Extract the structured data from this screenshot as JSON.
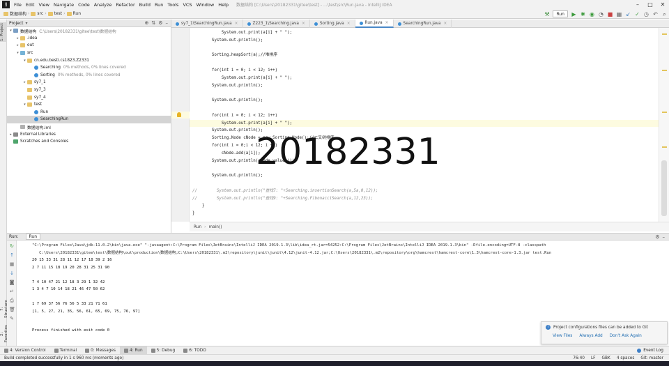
{
  "titlebar": {
    "logo": "IJ",
    "menus": [
      "File",
      "Edit",
      "View",
      "Navigate",
      "Code",
      "Analyze",
      "Refactor",
      "Build",
      "Run",
      "Tools",
      "VCS",
      "Window",
      "Help"
    ],
    "window_title": "数据结构 [C:\\Users\\20182331\\gitee\\test] - ...\\test\\src\\Run.java - IntelliJ IDEA"
  },
  "navbar": {
    "crumbs": [
      "数据结构",
      "src",
      "test",
      "Run"
    ],
    "run_config": "Run"
  },
  "project_panel": {
    "title": "Project",
    "rows": [
      {
        "indent": 0,
        "arrow": "▾",
        "icon": "module",
        "label": "数据结构",
        "muted": "C:\\Users\\20182331\\gitee\\test\\数据结构",
        "selected": false
      },
      {
        "indent": 1,
        "arrow": "▸",
        "icon": "folder",
        "label": ".idea",
        "muted": "",
        "selected": false
      },
      {
        "indent": 1,
        "arrow": "▸",
        "icon": "folder",
        "label": "out",
        "muted": "",
        "selected": false
      },
      {
        "indent": 1,
        "arrow": "▾",
        "icon": "src",
        "label": "src",
        "muted": "",
        "selected": false
      },
      {
        "indent": 2,
        "arrow": "▾",
        "icon": "folder",
        "label": "cn.edu.besti.cs1823.Z2331",
        "muted": "",
        "selected": false
      },
      {
        "indent": 3,
        "arrow": "",
        "icon": "java",
        "label": "Searching",
        "muted": "0% methods, 0% lines covered",
        "selected": false
      },
      {
        "indent": 3,
        "arrow": "",
        "icon": "java",
        "label": "Sorting",
        "muted": "0% methods, 0% lines covered",
        "selected": false
      },
      {
        "indent": 2,
        "arrow": "▸",
        "icon": "folder",
        "label": "sy7_1",
        "muted": "",
        "selected": false
      },
      {
        "indent": 2,
        "arrow": "",
        "icon": "folder",
        "label": "sy7_3",
        "muted": "",
        "selected": false
      },
      {
        "indent": 2,
        "arrow": "",
        "icon": "folder",
        "label": "sy7_4",
        "muted": "",
        "selected": false
      },
      {
        "indent": 2,
        "arrow": "▾",
        "icon": "folder",
        "label": "test",
        "muted": "",
        "selected": false
      },
      {
        "indent": 3,
        "arrow": "",
        "icon": "java",
        "label": "Run",
        "muted": "",
        "selected": false
      },
      {
        "indent": 3,
        "arrow": "",
        "icon": "java",
        "label": "SearchingRun",
        "muted": "",
        "selected": true
      },
      {
        "indent": 1,
        "arrow": "",
        "icon": "iml",
        "label": "数据结构.iml",
        "muted": "",
        "selected": false
      },
      {
        "indent": 0,
        "arrow": "▸",
        "icon": "lib",
        "label": "External Libraries",
        "muted": "",
        "selected": false
      },
      {
        "indent": 0,
        "arrow": "",
        "icon": "scratch",
        "label": "Scratches and Consoles",
        "muted": "",
        "selected": false
      }
    ]
  },
  "left_stripe": {
    "tabs": [
      "1: Project",
      "7: Structure",
      "2: Favorites"
    ]
  },
  "editor": {
    "tabs": [
      {
        "label": "sy7_1\\SearchingRun.java",
        "active": false
      },
      {
        "label": "Z223_1\\Searching.java",
        "active": false
      },
      {
        "label": "Sorting.java",
        "active": false
      },
      {
        "label": "Run.java",
        "active": true
      },
      {
        "label": "SearchingRun.java",
        "active": false
      }
    ],
    "code_lines": [
      {
        "text": "            System.out.print(a[i] + \" \");",
        "kind": "code"
      },
      {
        "text": "        System.out.println();",
        "kind": "code"
      },
      {
        "text": "",
        "kind": "code"
      },
      {
        "text": "        Sorting.heapSort(a);//堆排序",
        "kind": "code"
      },
      {
        "text": "",
        "kind": "code"
      },
      {
        "text": "        for(int i = 0; i < 12; i++)",
        "kind": "code"
      },
      {
        "text": "            System.out.print(a[i] + \" \");",
        "kind": "code"
      },
      {
        "text": "        System.out.println();",
        "kind": "code"
      },
      {
        "text": "",
        "kind": "code"
      },
      {
        "text": "        System.out.println();",
        "kind": "code"
      },
      {
        "text": "",
        "kind": "code"
      },
      {
        "text": "        for(int i = 0; i < 12; i++)",
        "kind": "code"
      },
      {
        "text": "            System.out.print(a[i] + \" \");",
        "kind": "highlight"
      },
      {
        "text": "        System.out.println();",
        "kind": "code"
      },
      {
        "text": "        Sorting.Node cNode = new Sorting.Node();//二叉树排序",
        "kind": "code"
      },
      {
        "text": "        for(int i = 0;i < 12; i ++)",
        "kind": "code"
      },
      {
        "text": "            cNode.add(a[i]);",
        "kind": "code"
      },
      {
        "text": "        System.out.println(cNode.values());",
        "kind": "code"
      },
      {
        "text": "",
        "kind": "code"
      },
      {
        "text": "        System.out.println();",
        "kind": "code"
      },
      {
        "text": "",
        "kind": "code"
      },
      {
        "text": "//        System.out.println(\"查找7: \"+Searching.insertionSearch(a,5a,0,12));",
        "kind": "comment"
      },
      {
        "text": "//        System.out.println(\"查找9: \"+Searching.FibonacciSearch(a,12,23));",
        "kind": "comment"
      },
      {
        "text": "    }",
        "kind": "code"
      },
      {
        "text": "}",
        "kind": "code"
      }
    ],
    "watermark": "20182331",
    "breadcrumbs": [
      "Run",
      "main()"
    ]
  },
  "run_panel": {
    "label": "Run:",
    "tab": "Run",
    "console_lines": [
      {
        "text": "\"C:\\Program Files\\Java\\jdk-11.0.2\\bin\\java.exe\" \"-javaagent:C:\\Program Files\\JetBrains\\IntelliJ IDEA 2019.1.3\\lib\\idea_rt.jar=54252:C:\\Program Files\\JetBrains\\IntelliJ IDEA 2019.1.3\\bin\" -Dfile.encoding=UTF-8 -classpath",
        "cmd": true
      },
      {
        "text": "   C:\\Users\\20182331\\gitee\\test\\数据结构\\out\\production\\数据结构;C:\\Users\\20182331\\.m2\\repository\\junit\\junit\\4.12\\junit-4.12.jar;C:\\Users\\20182331\\.m2\\repository\\org\\hamcrest\\hamcrest-core\\1.3\\hamcrest-core-1.3.jar test.Run",
        "cmd": true
      },
      {
        "text": "20 15 33 31 28 11 12 17 18 39 2 16",
        "cmd": false
      },
      {
        "text": "2 7 11 15 18 19 20 28 31 25 31 90",
        "cmd": false
      },
      {
        "text": "",
        "cmd": false
      },
      {
        "text": "7 4 10 47 21 12 18 3 29 1 32 42",
        "cmd": false
      },
      {
        "text": "1 3 4 7 10 14 18 21 46 47 50 62",
        "cmd": false
      },
      {
        "text": "",
        "cmd": false
      },
      {
        "text": "1 7 69 37 56 76 56 5 33 21 71 61",
        "cmd": false
      },
      {
        "text": "[1, 5, 27, 21, 35, 56, 61, 65, 69, 75, 76, 97]",
        "cmd": false
      },
      {
        "text": "",
        "cmd": false
      },
      {
        "text": "",
        "cmd": false
      },
      {
        "text": "Process finished with exit code 0",
        "cmd": false
      }
    ]
  },
  "notification": {
    "message": "Project configurations files can be added to Git",
    "links": [
      "View Files",
      "Always Add",
      "Don't Ask Again"
    ]
  },
  "bottom_stripe": {
    "tabs": [
      {
        "label": "4: Version Control",
        "active": false
      },
      {
        "label": "Terminal",
        "active": false
      },
      {
        "label": "0: Messages",
        "active": false
      },
      {
        "label": "4: Run",
        "active": true
      },
      {
        "label": "5: Debug",
        "active": false
      },
      {
        "label": "6: TODO",
        "active": false
      }
    ],
    "event_log": "Event Log"
  },
  "statusbar": {
    "message": "Build completed successfully in 1 s 960 ms (moments ago)",
    "right": [
      "76:40",
      "LF",
      "GBK",
      "4 spaces",
      "Git: master"
    ]
  },
  "colors": {
    "accent": "#4a88c7",
    "selection": "#d4d4d4",
    "highlight_line": "#fdfbe0"
  }
}
